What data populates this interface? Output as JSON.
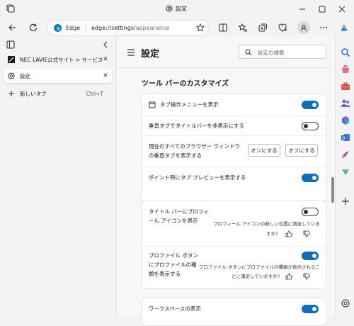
{
  "window": {
    "title": "設定"
  },
  "toolbar": {
    "site_label": "Edge",
    "url_host": "edge://settings",
    "url_path": "/appearance"
  },
  "tabs": [
    {
      "label": "NEC LAVIE公式サイト > サービス&サ",
      "active": false
    },
    {
      "label": "設定",
      "active": true
    }
  ],
  "new_tab": {
    "label": "新しいタブ",
    "shortcut": "Ctrl+T"
  },
  "settings": {
    "page_title": "設定",
    "search_placeholder": "設定の検索",
    "section_title": "ツール バーのカスタマイズ",
    "rows": {
      "tab_actions_menu": {
        "label": "タブ操作メニューを表示",
        "on": true
      },
      "hide_titlebar": {
        "label": "垂直タブでタイトルバーを非表示にする",
        "on": false
      },
      "vertical_tabs_all_windows": {
        "label_line1": "現在のすべてのブラウザー ウィンドウ",
        "label_line2": "の垂直タブを表示する",
        "on_button": "オンにする",
        "off_button": "オフにする"
      },
      "tab_preview_hover": {
        "label": "ポイント時にタブ プレビューを表示する",
        "on": true
      },
      "profile_icon_titlebar": {
        "label_line1": "タイトル バーにプロフィ",
        "label_line2": "ール アイコンを表示",
        "feedback_line1": "プロフィール アイコンの新しい位置に満足していま",
        "feedback_line2": "すか?",
        "on": false
      },
      "profile_type_button": {
        "label_line1": "プロファイル ボタン",
        "label_line2": "にプロファイルの種",
        "label_line3": "類を表示する",
        "feedback_line1": "プロファイル ボタンにプロファイルの種類が表示されるこ",
        "feedback_line2": "とに満足していますか?",
        "on": true
      },
      "workspaces": {
        "label": "ワークスペースの表示",
        "on": true
      }
    }
  },
  "colors": {
    "accent": "#0f6cbd",
    "background": "#f3f3f3",
    "card": "#ffffff"
  }
}
